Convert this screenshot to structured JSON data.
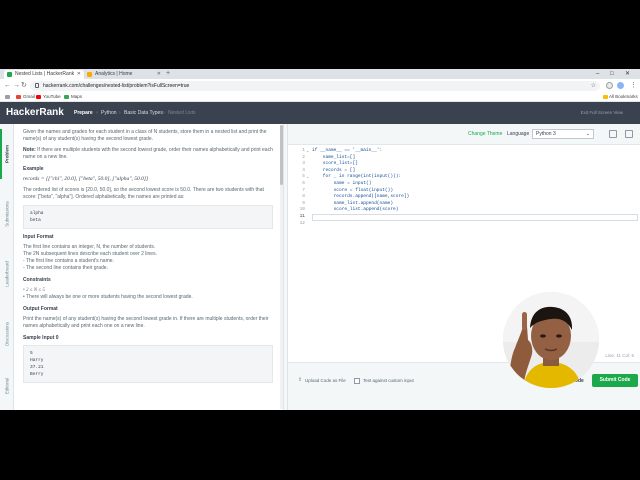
{
  "browser": {
    "tabs": [
      {
        "title": "Nested Lists | HackerRank",
        "active": true,
        "favicon_color": "#1ba94c"
      },
      {
        "title": "Analytics | Home",
        "active": false,
        "favicon_color": "#f9ab00"
      }
    ],
    "url": "hackerrank.com/challenges/nested-list/problem?isFullScreen=true",
    "bookmarks": [
      {
        "label": "Gmail",
        "icon": "gmail-icon",
        "color": "#ea4335"
      },
      {
        "label": "YouTube",
        "icon": "youtube-icon",
        "color": "#ff0000"
      },
      {
        "label": "Maps",
        "icon": "maps-icon",
        "color": "#34a853"
      }
    ],
    "all_bookmarks": "All Bookmarks"
  },
  "header": {
    "logo_text": "HackerRank",
    "logo_badge": "",
    "crumbs": [
      "Prepare",
      "Python",
      "Basic Data Types",
      "Nested Lists"
    ],
    "fullscreen": "Exit Full Screen View"
  },
  "rail": [
    "Problem",
    "Submissions",
    "Leaderboard",
    "Discussions",
    "Editorial"
  ],
  "problem": {
    "intro": "Given the names and grades for each student in a class of N students, store them in a nested list and print the name(s) of any student(s) having the second lowest grade.",
    "note_label": "Note:",
    "note": "If there are multiple students with the second lowest grade, order their names alphabetically and print each name on a new line.",
    "example_heading": "Example",
    "records": "records = [[\"chi\", 20.0], [\"beta\", 50.0], [\"alpha\", 50.0]]",
    "example_text": "The ordered list of scores is [20.0, 50.0], so the second lowest score is 50.0. There are two students with that score: [\"beta\", \"alpha\"]. Ordered alphabetically, the names are printed as:",
    "example_output": [
      "alpha",
      "beta"
    ],
    "input_heading": "Input Format",
    "input_lines": [
      "The first line contains an integer, N, the number of students.",
      "The 2N subsequent lines describe each student over 2 lines.",
      "- The first line contains a student's name.",
      "- The second line contains their grade."
    ],
    "constraints_heading": "Constraints",
    "constraints": [
      "2 ≤ N ≤ 5",
      "There will always be one or more students having the second lowest grade."
    ],
    "output_heading": "Output Format",
    "output_text": "Print the name(s) of any student(s) having the second lowest grade in. If there are multiple students, order their names alphabetically and print each one on a new line.",
    "sample_heading": "Sample Input 0",
    "sample_input": [
      "5",
      "Harry",
      "37.21",
      "Berry"
    ]
  },
  "editor": {
    "change_theme": "Change Theme",
    "language_label": "Language",
    "language": "Python 3",
    "lines": [
      "if __name__ == '__main__':",
      "    name_list=[]",
      "    score_list=[]",
      "    records = []",
      "    for _ in range(int(input())):",
      "        name = input()",
      "        score = float(input())",
      "        records.append([name,score])",
      "        name_list.append(name)",
      "        score_list.append(score)",
      "",
      ""
    ],
    "cursor_line": 11,
    "status": "Line: 11 Col: 5",
    "upload": "Upload Code as File",
    "custom_input": "Test against custom input",
    "run": "Run Code",
    "submit": "Submit Code"
  }
}
